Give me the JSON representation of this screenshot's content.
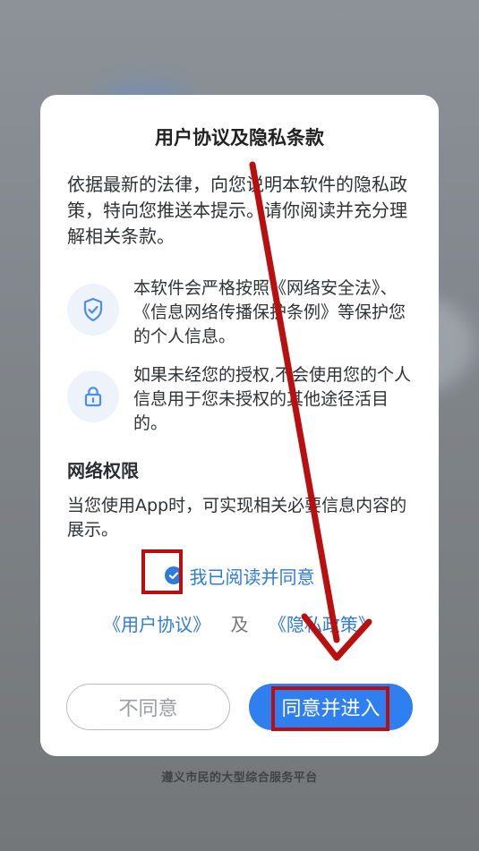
{
  "background": {
    "footer_text": "遵义市民的大型综合服务平台"
  },
  "dialog": {
    "title": "用户协议及隐私条款",
    "intro": "依据最新的法律，向您说明本软件的隐私政策，特向您推送本提示。请你阅读并充分理解相关条款。",
    "features": [
      {
        "icon": "shield-check-icon",
        "text": "本软件会严格按照《网络安全法》、《信息网络传播保护条例》等保护您的个人信息。"
      },
      {
        "icon": "lock-icon",
        "text": "如果未经您的授权,不会使用您的个人信息用于您未授权的其他途径活目的。"
      }
    ],
    "network_permission": {
      "title": "网络权限",
      "text": "当您使用App时，可实现相关必要信息内容的展示。"
    },
    "consent": {
      "checked": true,
      "label": "我已阅读并同意"
    },
    "agreements": {
      "user_agreement": "《用户协议》",
      "and": "及",
      "privacy_policy": "《隐私政策》"
    },
    "buttons": {
      "decline": "不同意",
      "accept": "同意并进入"
    }
  },
  "colors": {
    "accent": "#2f7ff0",
    "link": "#2f7bd9",
    "annotation": "#b90f0f"
  }
}
